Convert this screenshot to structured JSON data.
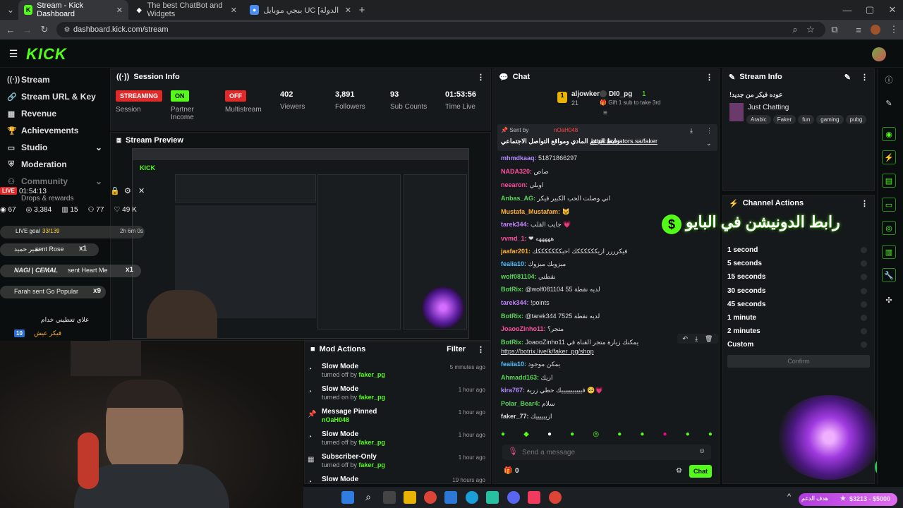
{
  "browser": {
    "tabs": [
      {
        "label": "Stream - Kick Dashboard"
      },
      {
        "label": "The best ChatBot and Widgets"
      },
      {
        "label": "ببجي موبايل UC [اسم الدولة] | خـ..."
      }
    ],
    "url": "dashboard.kick.com/stream",
    "new_tab": "+"
  },
  "brand": {
    "logo": "KICK",
    "accent": "#53fc18"
  },
  "sidebar": {
    "items": [
      {
        "label": "Stream"
      },
      {
        "label": "Stream URL & Key"
      },
      {
        "label": "Revenue"
      },
      {
        "label": "Achievements"
      },
      {
        "label": "Studio"
      },
      {
        "label": "Moderation"
      },
      {
        "label": "Community"
      }
    ]
  },
  "session": {
    "title": "Session Info",
    "stats": [
      {
        "badge": "STREAMING",
        "label": "Session"
      },
      {
        "badge": "ON",
        "label": "Partner Income"
      },
      {
        "badge": "OFF",
        "label": "Multistream"
      },
      {
        "value": "402",
        "label": "Viewers"
      },
      {
        "value": "3,891",
        "label": "Followers"
      },
      {
        "value": "93",
        "label": "Sub Counts"
      },
      {
        "value": "01:53:56",
        "label": "Time Live"
      }
    ]
  },
  "preview": {
    "title": "Stream Preview"
  },
  "overlay": {
    "live": "LIVE",
    "time": "01:54:13",
    "drops": "Drops & rewards",
    "stats": [
      {
        "v": "67"
      },
      {
        "v": "3,384"
      },
      {
        "v": "15"
      },
      {
        "v": "77"
      },
      {
        "v": "49 K"
      }
    ],
    "goal": "LIVE goal",
    "goal_count": "33/139",
    "goal_time": "2h 6m 0s",
    "gifts": [
      {
        "user": "نمير حميد",
        "text": "sent Rose",
        "count": "x1"
      },
      {
        "user": "NAGI | CEMAL",
        "text": "sent Heart Me",
        "count": "x1"
      },
      {
        "user": "Farah",
        "text": "sent Go Popular",
        "count": "x9"
      }
    ],
    "comment": "علاي تعطيني خدام",
    "lvl": "10",
    "lvl_user": "فيكر عيش"
  },
  "chat": {
    "title": "Chat",
    "top_user": "aljowker",
    "top_count": "21",
    "sub_user": "DI0_pg",
    "sub_count": "1",
    "sub_text": "Gift 1 sub to take 3rd",
    "pinned_by": "Sent by",
    "pinned_user": "nOaH048",
    "pinned_text": "رابط الدعم المادي ومواقع التواصل الاجتماعي",
    "pinned_link": "https://creators.sa/faker",
    "messages": [
      {
        "user": "mhmdkaaq:",
        "text": "51871866297",
        "color": "#b48cff"
      },
      {
        "user": "NADA320:",
        "text": "صاص",
        "color": "#ff4fa3"
      },
      {
        "user": "neearon:",
        "text": "اوبلي",
        "color": "#ff4fa3"
      },
      {
        "user": "Anbas_AG:",
        "text": "اني وصلت الحب الكبير فيكر",
        "color": "#5ad35a"
      },
      {
        "user": "Mustafa_Mustafam:",
        "text": "🐱",
        "color": "#ffb030"
      },
      {
        "user": "tarek344:",
        "text": "جايب القلب 💗",
        "color": "#c080ff"
      },
      {
        "user": "vvmd_1:",
        "text": "❤ هههههه",
        "color": "#ff4fa3"
      },
      {
        "user": "jaafar201:",
        "text": "فيكرررر ازيككككككك احبكككككككك",
        "color": "#ffb030"
      },
      {
        "user": "feaiia10:",
        "text": "ميزوبك ميزوك",
        "color": "#4fc3ff"
      },
      {
        "user": "wolf081104:",
        "text": "نقطتي",
        "color": "#5ad35a"
      },
      {
        "user": "BotRix:",
        "text": "@wolf081104 55 لديه نقطة",
        "color": "#5ad35a"
      },
      {
        "user": "tarek344:",
        "text": "!points",
        "color": "#c080ff"
      },
      {
        "user": "BotRix:",
        "text": "@tarek344 7525 لديه نقطة",
        "color": "#5ad35a"
      },
      {
        "user": "JoaooZinho11:",
        "text": "متجر؟",
        "color": "#ff4fa3"
      },
      {
        "user": "BotRix:",
        "text": "JoaooZinho11 يمكنك زيارة متجر القناة في",
        "color": "#5ad35a"
      },
      {
        "user": "",
        "text": "https://botrix.live/k/faker_pg/shop",
        "color": "#fff"
      },
      {
        "user": "feaiia10:",
        "text": "يمكن موجود",
        "color": "#4fc3ff"
      },
      {
        "user": "Ahmadd163:",
        "text": "ازيك",
        "color": "#5ad35a"
      },
      {
        "user": "kira767:",
        "text": "فيييييييييييك حطي زرية 🥺💗",
        "color": "#b48cff"
      },
      {
        "user": "Polar_Bear4:",
        "text": "سلام",
        "color": "#5ad35a"
      },
      {
        "user": "faker_77:",
        "text": "ازييييييك",
        "color": "#ddd"
      }
    ],
    "placeholder": "Send a message",
    "button": "Chat",
    "points": "0"
  },
  "mod": {
    "title": "Mod Actions",
    "filter": "Filter",
    "items": [
      {
        "action": "Slow Mode",
        "desc": "turned off by",
        "user": "faker_pg",
        "time": "5 minutes ago"
      },
      {
        "action": "Slow Mode",
        "desc": "turned on by",
        "user": "faker_pg",
        "time": "1 hour ago"
      },
      {
        "action": "Message Pinned",
        "desc": "",
        "user": "nOaH048",
        "time": "1 hour ago"
      },
      {
        "action": "Slow Mode",
        "desc": "turned off by",
        "user": "faker_pg",
        "time": "1 hour ago"
      },
      {
        "action": "Subscriber-Only",
        "desc": "turned off by",
        "user": "faker_pg",
        "time": "1 hour ago"
      },
      {
        "action": "Slow Mode",
        "desc": "",
        "user": "",
        "time": "19 hours ago"
      }
    ]
  },
  "streaminfo": {
    "title": "Stream Info",
    "stream_title": "!عوده فيكر من جديد",
    "category": "Just Chatting",
    "tags": [
      "Arabic",
      "Faker",
      "fun",
      "gaming",
      "pubg"
    ]
  },
  "channel_actions": {
    "title": "Channel Actions",
    "durations": [
      "1 second",
      "5 seconds",
      "15 seconds",
      "30 seconds",
      "45 seconds",
      "1 minute",
      "2 minutes",
      "Custom"
    ],
    "confirm": "Confirm"
  },
  "overlay_banner": {
    "text": "رابط الدونيشن في البايو",
    "goal": "$3213 - $5000",
    "goal_label": "هدف الدعم"
  }
}
